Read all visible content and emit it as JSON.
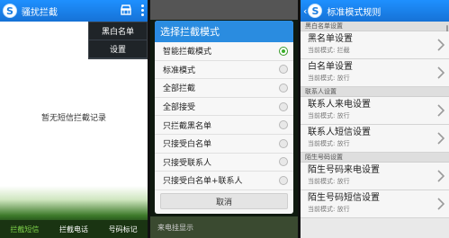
{
  "screen1": {
    "title": "骚扰拦截",
    "menu": [
      "黑白名单",
      "设置"
    ],
    "empty_message": "暂无短信拦截记录",
    "tabs": [
      {
        "label": "拦截短信",
        "active": true
      },
      {
        "label": "拦截电话",
        "active": false
      },
      {
        "label": "号码标记",
        "active": false
      }
    ]
  },
  "screen2": {
    "dialog_title": "选择拦截模式",
    "options": [
      {
        "label": "智能拦截模式",
        "selected": true
      },
      {
        "label": "标准模式",
        "selected": false
      },
      {
        "label": "全部拦截",
        "selected": false
      },
      {
        "label": "全部接受",
        "selected": false
      },
      {
        "label": "只拦截黑名单",
        "selected": false
      },
      {
        "label": "只接受白名单",
        "selected": false
      },
      {
        "label": "只接受联系人",
        "selected": false
      },
      {
        "label": "只接受白名单+联系人",
        "selected": false
      }
    ],
    "cancel_label": "取消",
    "bottom_text": "来电挂显示"
  },
  "screen3": {
    "title": "标准模式规则",
    "sections": [
      {
        "header": "黑白名单设置",
        "rows": [
          {
            "title": "黑名单设置",
            "sub": "当前模式: 拦截"
          },
          {
            "title": "白名单设置",
            "sub": "当前模式: 放行"
          }
        ]
      },
      {
        "header": "联系人设置",
        "rows": [
          {
            "title": "联系人来电设置",
            "sub": "当前模式: 放行"
          },
          {
            "title": "联系人短信设置",
            "sub": "当前模式: 放行"
          }
        ]
      },
      {
        "header": "陌生号码设置",
        "rows": [
          {
            "title": "陌生号码来电设置",
            "sub": "当前模式: 放行"
          },
          {
            "title": "陌生号码短信设置",
            "sub": "当前模式: 放行"
          }
        ]
      }
    ]
  },
  "colors": {
    "appbar": "#1e90ff",
    "dialog_title": "#2a8ce0",
    "active_tab": "#7fd34a",
    "radio_selected": "#3ab02a"
  },
  "icons": [
    "logo-icon",
    "broom-icon",
    "overflow-menu-icon",
    "back-arrow-icon",
    "chevron-right-icon"
  ]
}
